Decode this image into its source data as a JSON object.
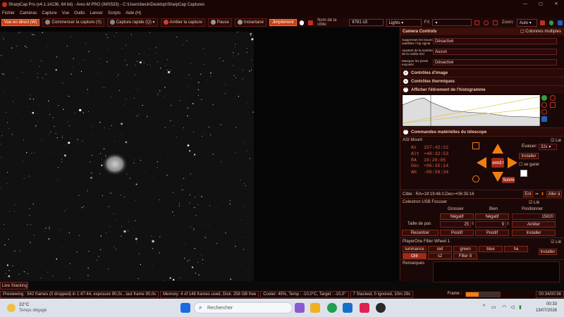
{
  "window": {
    "title": "SharpCap Pro (v4.1.14136, 64 bit) - Ares-M PRO (IMX533) - C:\\Users\\beck\\Desktop\\SharpCap Captures",
    "controls": [
      "—",
      "▢",
      "✕"
    ]
  },
  "menu": [
    "Fichier",
    "Caméras",
    "Capture",
    "Vue",
    "Outils",
    "Lancer",
    "Scripts",
    "Aide (H)"
  ],
  "toolbar": {
    "live": "Vue en direct (W)",
    "start": "Commencer la capture (S)",
    "quick": "Capture rapide (Q)",
    "stop": "Arrêter la capture",
    "pause": "Pause",
    "snapshot": "Instantané",
    "timelapse": "Jimplement",
    "target_label": "Nom de la cible:",
    "target_value": "6781 o3",
    "frame_type": "Lights",
    "fx_label": "FX",
    "zoom_label": "Zoom:",
    "zoom_value": "Auto"
  },
  "panel": {
    "header": "Camera Controls",
    "columns_label": "Colonnes multiples",
    "rows": [
      {
        "label": "Suppresser les traces satellites / bip signal",
        "value": "Désactivé"
      },
      {
        "label": "Ajoutant de la tombée de la nuit/la réel",
        "value": "Aucun"
      },
      {
        "label": "Masquer les pixels exposés",
        "value": "Désactivé"
      }
    ],
    "sections": {
      "image": "Contrôles d'image",
      "thermal": "Contrôles thermiques",
      "histogram": "Afficher l'étirement de l'histogramme",
      "telescope": "Commandes matérielles du télescope"
    },
    "mount": {
      "name": "ASI Mount",
      "linked": "Lié",
      "az": "157:42:22",
      "alt": "+48:32:53",
      "ra": "19:20:05",
      "dec": "+06:35:14",
      "ah": "-00:58:34",
      "labels": {
        "az": "Az",
        "alt": "Alt",
        "ra": "RA",
        "dec": "Déc",
        "ah": "AH"
      },
      "rate_label": "Évaluer:",
      "rate_value": "32x",
      "install": "Installer",
      "park": "se garer",
      "stop": "ARRÊT",
      "follow": "Suivre",
      "target": "Cible : RA=19:19:48.0,Dec=+06:35:16",
      "ent": "Ent",
      "goto": "Aller à"
    },
    "focuser": {
      "name": "Celestron USB Focuser",
      "linked": "Lié",
      "coarse": "Grossier",
      "fine": "Bien",
      "position_label": "Positionner",
      "negative": "Négatif",
      "positive": "Positif",
      "position": "15820",
      "step_label": "Taille de pas",
      "step_coarse": "25",
      "step_fine": "9",
      "stop": "Arrêter",
      "reset": "Recentrer",
      "install": "Installer"
    },
    "filterwheel": {
      "name": "PlayerOne Filter Wheel 1",
      "linked": "Lié",
      "filters": [
        "luminance",
        "red",
        "green",
        "blue",
        "ha",
        "OIII",
        "s2",
        "Filter 8"
      ],
      "active": "OIII",
      "install": "Installer"
    },
    "notes_label": "Remarques"
  },
  "live_stacking": "Live Stacking",
  "status": {
    "preview": "Previewing : 542 frames (0 dropped) in 1:47:44, exposure 90,0s , last frame 90,0s",
    "memory": "Memory: 4 of 148 frames used, Disk: 258 GB free",
    "cooler": "Cooler: 45%, Temp : -10,0°C, Target : -10,0°",
    "stack": "7 Stacked, 0 Ignored, 10m 29s",
    "frame_label": "Frame :",
    "timer": "00:34/00:56"
  },
  "taskbar": {
    "weather_temp": "22°C",
    "weather_text": "Temps dégagé",
    "search": "Rechercher",
    "time": "00:33",
    "date": "13/07/2026"
  }
}
